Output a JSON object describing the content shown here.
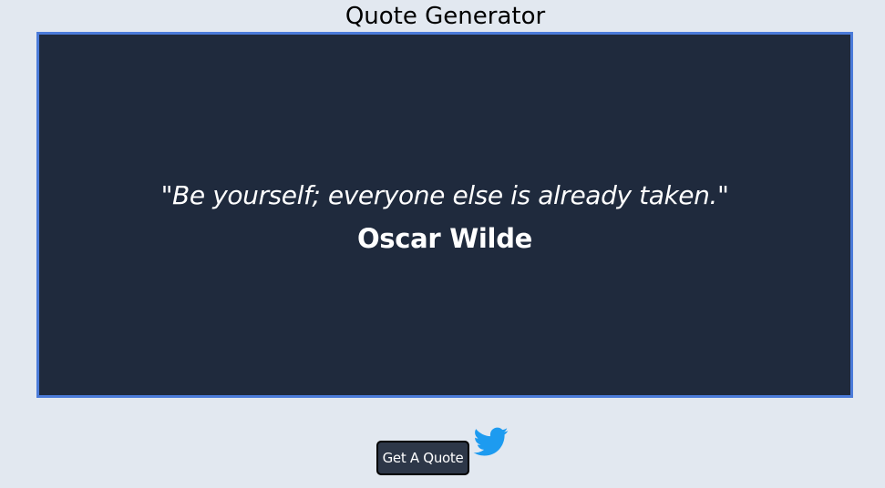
{
  "header": {
    "title": "Quote Generator"
  },
  "quote": {
    "text": "\"Be yourself; everyone else is already taken.\"",
    "author": "Oscar Wilde"
  },
  "actions": {
    "get_quote_label": "Get A Quote",
    "tweet_icon": "twitter-bird-icon"
  },
  "colors": {
    "background": "#e2e8f0",
    "quote_box": "#1f2a3d",
    "quote_border": "#4b7bd9",
    "button": "#2d3748",
    "twitter": "#1d9bf0"
  }
}
